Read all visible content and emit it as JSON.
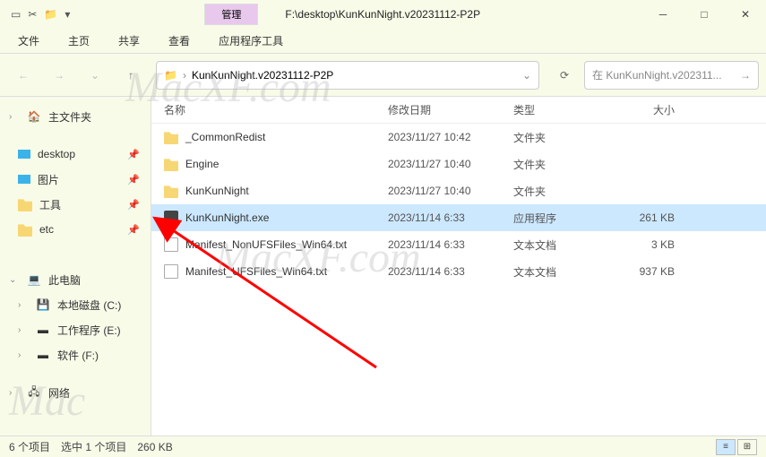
{
  "titlebar": {
    "manage_label": "管理",
    "path": "F:\\desktop\\KunKunNight.v20231112-P2P"
  },
  "menubar": {
    "file": "文件",
    "home": "主页",
    "share": "共享",
    "view": "查看",
    "apptools": "应用程序工具"
  },
  "address": {
    "crumb": "KunKunNight.v20231112-P2P"
  },
  "search": {
    "placeholder": "在 KunKunNight.v202311..."
  },
  "sidebar": {
    "home": "主文件夹",
    "items": [
      {
        "label": "desktop"
      },
      {
        "label": "图片"
      },
      {
        "label": "工具"
      },
      {
        "label": "etc"
      }
    ],
    "thispc": "此电脑",
    "drives": [
      {
        "label": "本地磁盘 (C:)"
      },
      {
        "label": "工作程序 (E:)"
      },
      {
        "label": "软件 (F:)"
      }
    ],
    "network": "网络"
  },
  "columns": {
    "name": "名称",
    "date": "修改日期",
    "type": "类型",
    "size": "大小"
  },
  "files": [
    {
      "name": "_CommonRedist",
      "date": "2023/11/27 10:42",
      "type": "文件夹",
      "size": "",
      "icon": "folder"
    },
    {
      "name": "Engine",
      "date": "2023/11/27 10:40",
      "type": "文件夹",
      "size": "",
      "icon": "folder"
    },
    {
      "name": "KunKunNight",
      "date": "2023/11/27 10:40",
      "type": "文件夹",
      "size": "",
      "icon": "folder"
    },
    {
      "name": "KunKunNight.exe",
      "date": "2023/11/14 6:33",
      "type": "应用程序",
      "size": "261 KB",
      "icon": "exe",
      "selected": true
    },
    {
      "name": "Manifest_NonUFSFiles_Win64.txt",
      "date": "2023/11/14 6:33",
      "type": "文本文档",
      "size": "3 KB",
      "icon": "file"
    },
    {
      "name": "Manifest_UFSFiles_Win64.txt",
      "date": "2023/11/14 6:33",
      "type": "文本文档",
      "size": "937 KB",
      "icon": "file"
    }
  ],
  "status": {
    "count": "6 个项目",
    "selected": "选中 1 个项目",
    "size": "260 KB"
  }
}
